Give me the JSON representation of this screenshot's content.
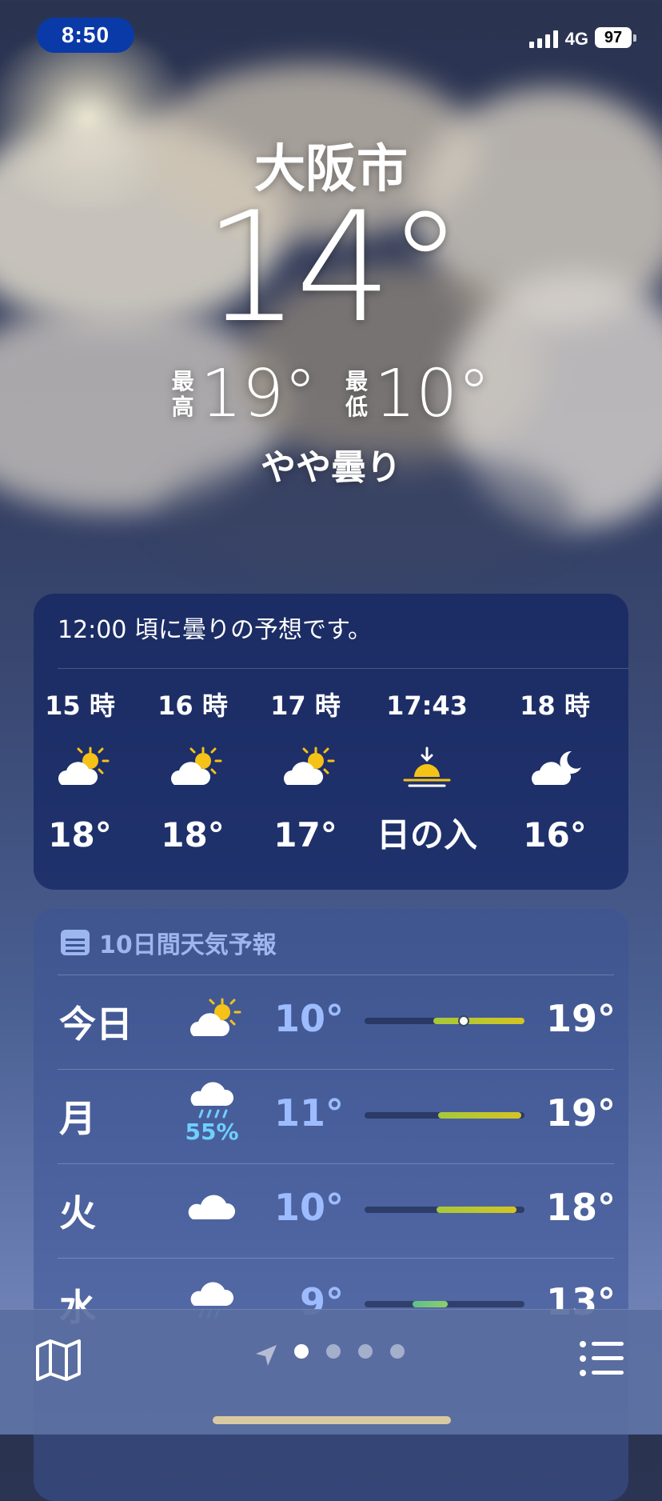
{
  "status": {
    "time": "8:50",
    "network": "4G",
    "battery": "97"
  },
  "hero": {
    "city": "大阪市",
    "temperature": "14°",
    "high_label_1": "最",
    "high_label_2": "高",
    "high": "19°",
    "low_label_1": "最",
    "low_label_2": "低",
    "low": "10°",
    "condition": "やや曇り"
  },
  "hourly": {
    "summary": "12:00 頃に曇りの予想です。",
    "items": [
      {
        "time": "15 時",
        "icon": "partly-sunny-icon",
        "temp": "18°"
      },
      {
        "time": "16 時",
        "icon": "partly-sunny-icon",
        "temp": "18°"
      },
      {
        "time": "17 時",
        "icon": "partly-sunny-icon",
        "temp": "17°"
      },
      {
        "time": "17:43",
        "icon": "sunset-icon",
        "temp": "日の入"
      },
      {
        "time": "18 時",
        "icon": "cloudy-night-icon",
        "temp": "16°"
      }
    ]
  },
  "daily": {
    "header": "10日間天気予報",
    "rows": [
      {
        "day": "今日",
        "icon": "partly-sunny-icon",
        "precip": "",
        "low": "10°",
        "high": "19°",
        "range_start": 0.43,
        "range_end": 1.0,
        "current": 0.62
      },
      {
        "day": "月",
        "icon": "rain-icon",
        "precip": "55%",
        "low": "11°",
        "high": "19°",
        "range_start": 0.46,
        "range_end": 0.98
      },
      {
        "day": "火",
        "icon": "cloud-icon",
        "precip": "",
        "low": "10°",
        "high": "18°",
        "range_start": 0.45,
        "range_end": 0.95
      },
      {
        "day": "水",
        "icon": "rain-icon",
        "precip": "",
        "low": "9°",
        "high": "13°",
        "range_start": 0.3,
        "range_end": 0.52
      }
    ]
  },
  "toolbar": {
    "page_count": 4,
    "active_page": 0
  },
  "colors": {
    "time_pill": "#0a3aa8",
    "low_temp": "#9dbcff",
    "precip": "#6fd0ff",
    "sun": "#f5c218"
  }
}
